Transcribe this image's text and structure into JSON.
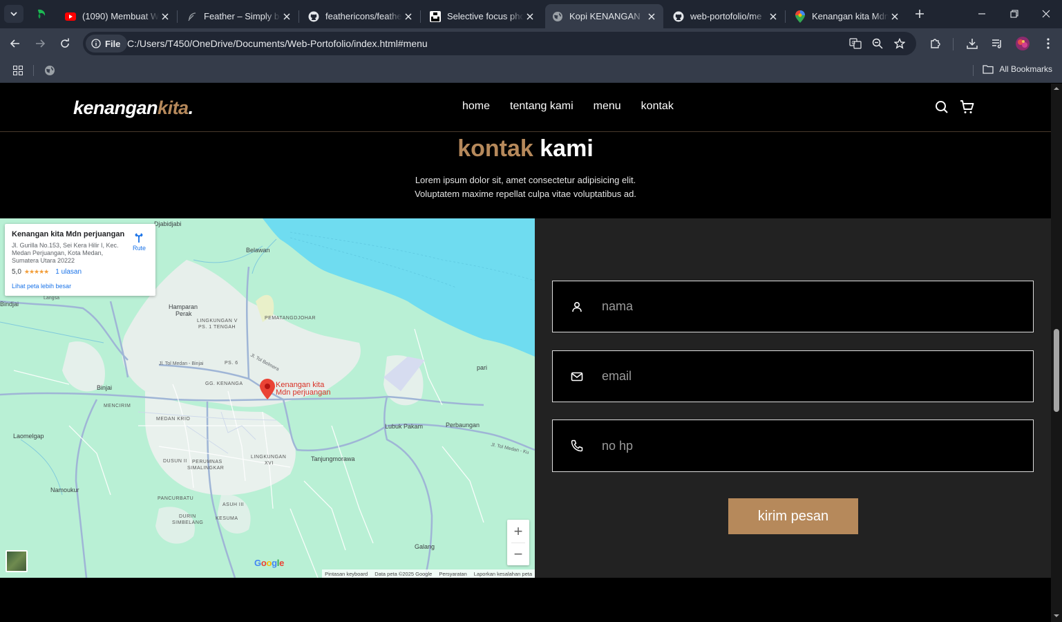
{
  "browser": {
    "tabs": [
      {
        "title": "(1090) Membuat W",
        "favicon": "youtube-icon",
        "active": false
      },
      {
        "title": "Feather – Simply be",
        "favicon": "feather-icon",
        "active": false
      },
      {
        "title": "feathericons/feathe",
        "favicon": "github-icon",
        "active": false
      },
      {
        "title": "Selective focus phot",
        "favicon": "unsplash-icon",
        "active": false
      },
      {
        "title": "Kopi KENANGAN",
        "favicon": "globe-icon",
        "active": true
      },
      {
        "title": "web-portofolio/me",
        "favicon": "github-icon",
        "active": false
      },
      {
        "title": "Kenangan kita Mdn",
        "favicon": "google-maps-icon",
        "active": false
      }
    ],
    "site_chip": "File",
    "url": "C:/Users/T450/OneDrive/Documents/Web-Portofolio/index.html#menu",
    "all_bookmarks": "All Bookmarks"
  },
  "site": {
    "logo_main": "kenangan",
    "logo_accent": "kita",
    "logo_dot": ".",
    "nav": [
      "home",
      "tentang kami",
      "menu",
      "kontak"
    ],
    "heading_accent": "kontak",
    "heading_main": "kami",
    "subtitle": "Lorem ipsum dolor sit, amet consectetur adipisicing elit. Voluptatem maxime repellat culpa vitae voluptatibus ad.",
    "form": {
      "name_placeholder": "nama",
      "email_placeholder": "email",
      "phone_placeholder": "no hp",
      "submit_label": "kirim pesan"
    }
  },
  "map": {
    "place_name": "Kenangan kita Mdn perjuangan",
    "address": "Jl. Gurilla No.153, Sei Kera Hilir I, Kec. Medan Perjuangan, Kota Medan, Sumatera Utara 20222",
    "rating": "5,0",
    "stars": "★★★★★",
    "reviews": "1 ulasan",
    "larger_map_link": "Lihat peta lebih besar",
    "route_label": "Rute",
    "pin_label_1": "Kenangan kita",
    "pin_label_2": "Mdn perjuangan",
    "labels": [
      "Djabidjabi",
      "Belawan",
      "Bindjai",
      "Langsa",
      "Hamparan",
      "Perak",
      "LINGKUNGAN V",
      "PS. 1 TENGAH",
      "PEMATANGDJOHAR",
      "PS. 6",
      "Jl. Tol Belmera",
      "Jl. Tol Medan - Binjai",
      "GG. KENANGA",
      "Binjai",
      "MENCIRIM",
      "MEDAN KRIO",
      "pari",
      "Lubuk Pakam",
      "Perbaungan",
      "Laomelgap",
      "LINGKUNGAN",
      "XVI",
      "Tanjungmorawa",
      "Jl. Tol Medan - Ku",
      "DUSUN II",
      "PERUMNAS",
      "SIMALINGKAR",
      "Namoukur",
      "PANCURBATU",
      "ASUH III",
      "DURIN",
      "SIMBELANG",
      "KESUMA",
      "Galang"
    ],
    "attribution": [
      "Pintasan keyboard",
      "Data peta ©2025 Google",
      "Persyaratan",
      "Laporkan kesalahan peta"
    ],
    "google_logo": "Google"
  },
  "colors": {
    "accent": "#b6895b",
    "background": "#000000",
    "section": "#222222",
    "browser_chrome": "#353c4a",
    "map_land": "#b9f0d5",
    "map_sea": "#6fdcf0"
  }
}
